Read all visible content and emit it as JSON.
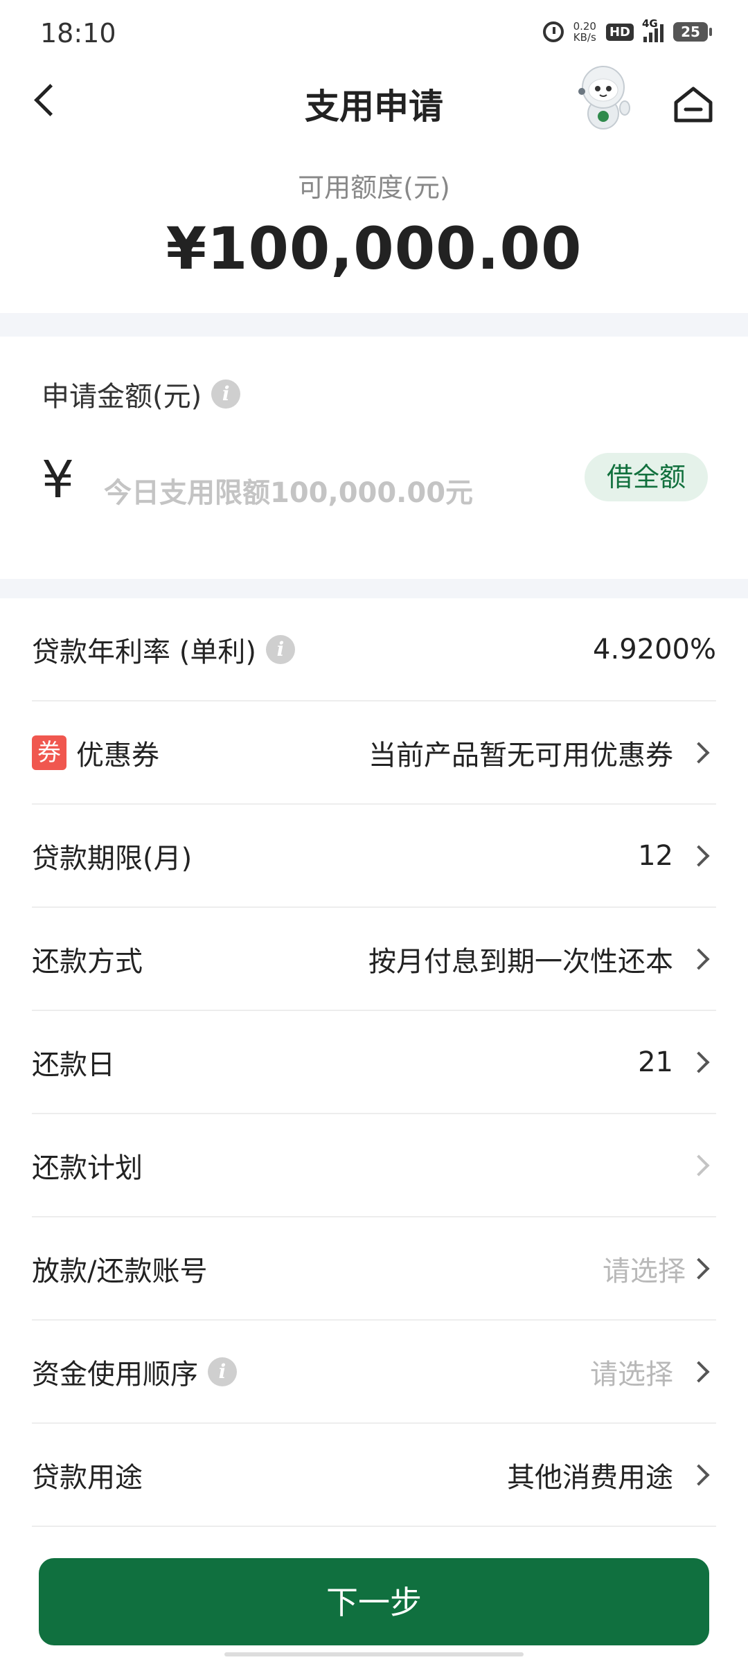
{
  "status_bar": {
    "time": "18:10",
    "net_speed_value": "0.20",
    "net_speed_unit": "KB/s",
    "hd": "HD",
    "network": "4G",
    "battery": "25"
  },
  "header": {
    "title": "支用申请"
  },
  "quota": {
    "label": "可用额度(元)",
    "value": "¥100,000.00"
  },
  "apply": {
    "label": "申请金额(元)",
    "currency": "¥",
    "placeholder": "今日支用限额100,000.00元",
    "borrow_all": "借全额"
  },
  "rows": {
    "rate": {
      "label": "贷款年利率 (单利)",
      "value": "4.9200%"
    },
    "coupon": {
      "badge": "券",
      "label": "优惠券",
      "value": "当前产品暂无可用优惠券"
    },
    "term": {
      "label": "贷款期限(月)",
      "value": "12"
    },
    "method": {
      "label": "还款方式",
      "value": "按月付息到期一次性还本"
    },
    "day": {
      "label": "还款日",
      "value": "21"
    },
    "plan": {
      "label": "还款计划"
    },
    "account": {
      "label": "放款/还款账号",
      "value": "请选择"
    },
    "order": {
      "label": "资金使用顺序",
      "value": "请选择"
    },
    "purpose": {
      "label": "贷款用途",
      "value": "其他消费用途"
    }
  },
  "footer": {
    "next": "下一步"
  },
  "colors": {
    "primary": "#10703f",
    "chip_bg": "#e5f2ea",
    "coupon_red": "#f0574f",
    "section_gap": "#f3f5f9"
  }
}
